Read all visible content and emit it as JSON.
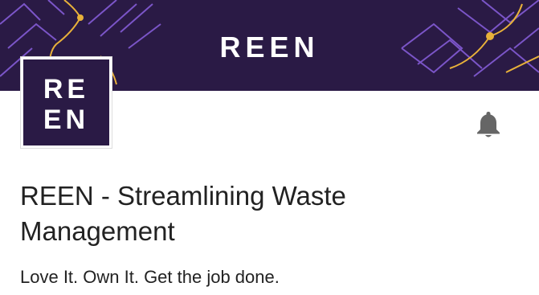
{
  "banner": {
    "logo_text": "REEN",
    "background_color": "#2a1a45",
    "accent_color": "#e8b13a"
  },
  "app_icon": {
    "line1": "RE",
    "line2": "EN"
  },
  "header": {
    "bell_icon": "bell-icon"
  },
  "app": {
    "title": "REEN - Streamlining Waste Management",
    "tagline": "Love It. Own It. Get the job done."
  }
}
